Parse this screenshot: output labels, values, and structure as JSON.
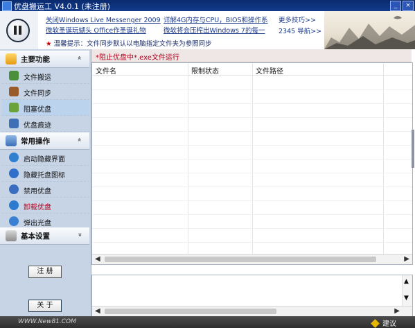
{
  "window": {
    "title": "优盘搬运工 V4.0.1   (未注册)"
  },
  "banner": {
    "news": [
      "关闭Windows Live Messenger 2009",
      "微软圣诞玩蝴头 Office作圣诞礼物",
      "详解4G内存与CPU，BIOS和操作系",
      "微软将会压榨出Windows 7的每一"
    ],
    "more_tips": "更多技巧>>",
    "nav_2345": "2345 导航>>",
    "tip_star": "★",
    "tip": "温馨提示：文件同步默认以电脑指定文件夹为参照同步"
  },
  "sidebar": {
    "sections": [
      {
        "label": "主要功能",
        "chevron": "»"
      },
      {
        "label": "常用操作",
        "chevron": "»"
      },
      {
        "label": "基本设置",
        "chevron": "»"
      }
    ],
    "main_items": [
      "文件搬运",
      "文件同步",
      "阻塞优盘",
      "优盘痕迹"
    ],
    "ops_items": [
      "启动隐藏界面",
      "隐藏托盘图标",
      "禁用优盘",
      "卸载优盘",
      "弹出光盘"
    ],
    "register_label": "注 册",
    "about_label": "关 于"
  },
  "main": {
    "block_hint": "*阻止优盘中*.exe文件运行",
    "columns": [
      "文件名",
      "限制状态",
      "文件路径"
    ]
  },
  "statusbar": {
    "site": "WWW.New81.COM",
    "suggest": "建议"
  },
  "icons": {
    "pause": "pause-icon",
    "dropdown": "chevron-down-icon"
  },
  "colors": {
    "title_bar": "#0a2a6e",
    "sidebar_bg": "#c7d4e6",
    "active_item": "#bcd3ee",
    "hint_red": "#b3001b",
    "status_bar": "#3a3a3a"
  }
}
